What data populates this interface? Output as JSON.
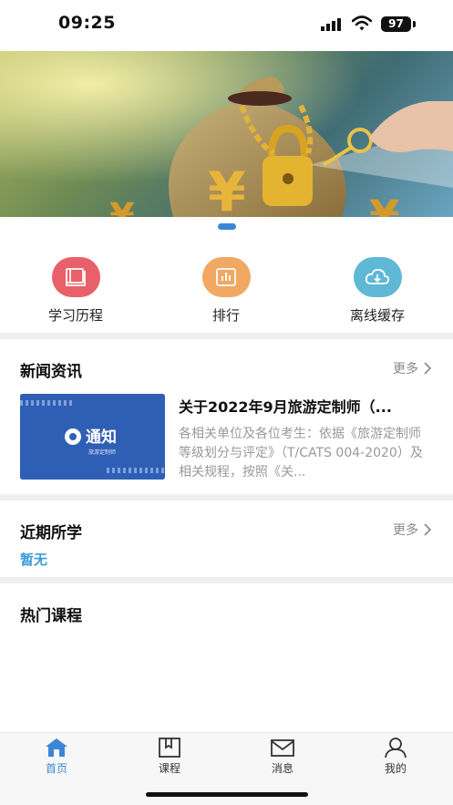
{
  "status_bar": {
    "time": "09:25",
    "battery": "97"
  },
  "banner": {
    "images": [
      "money-bag-lock-key-banner"
    ]
  },
  "quick_actions": [
    {
      "label": "学习历程",
      "icon": "book-icon",
      "color": "#e9606a"
    },
    {
      "label": "排行",
      "icon": "bar-chart-icon",
      "color": "#f0a862"
    },
    {
      "label": "离线缓存",
      "icon": "cloud-download-icon",
      "color": "#5fb8d6"
    }
  ],
  "news": {
    "title": "新闻资讯",
    "more": "更多",
    "items": [
      {
        "title": "关于2022年9月旅游定制师（...",
        "desc": "各相关单位及各位考生：依据《旅游定制师等级划分与评定》（T/CATS 004-2020）及相关规程，按照《关...",
        "thumb_text": "通知",
        "thumb_sub": "旅游定制师"
      }
    ]
  },
  "recent": {
    "title": "近期所学",
    "more": "更多",
    "empty": "暂无"
  },
  "hot": {
    "title": "热门课程"
  },
  "tabs": [
    {
      "label": "首页",
      "icon": "home-icon",
      "active": true
    },
    {
      "label": "课程",
      "icon": "course-book-icon",
      "active": false
    },
    {
      "label": "消息",
      "icon": "mail-icon",
      "active": false
    },
    {
      "label": "我的",
      "icon": "person-icon",
      "active": false
    }
  ],
  "colors": {
    "accent": "#3b86d6",
    "empty_text": "#3b9ad9"
  }
}
